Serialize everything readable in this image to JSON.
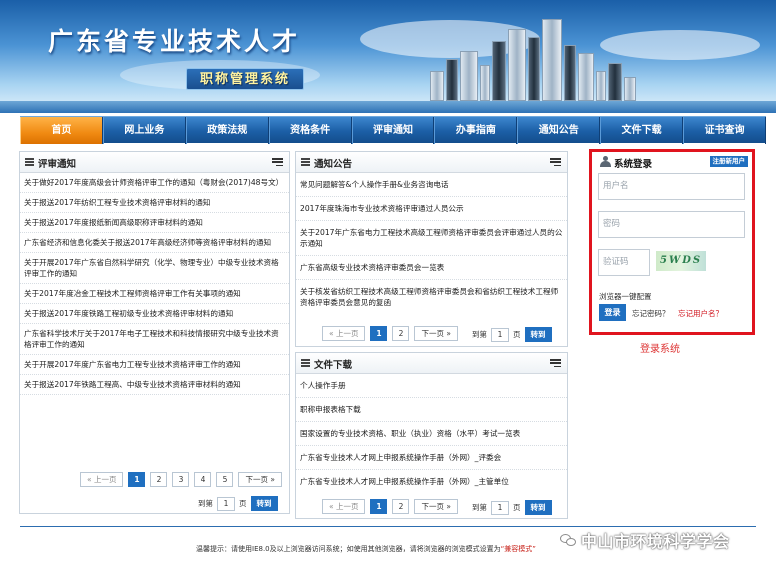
{
  "header": {
    "title": "广东省专业技术人才",
    "subtitle": "职称管理系统"
  },
  "nav": {
    "items": [
      {
        "label": "首页",
        "active": true
      },
      {
        "label": "网上业务"
      },
      {
        "label": "政策法规"
      },
      {
        "label": "资格条件"
      },
      {
        "label": "评审通知"
      },
      {
        "label": "办事指南"
      },
      {
        "label": "通知公告"
      },
      {
        "label": "文件下载"
      },
      {
        "label": "证书查询"
      }
    ]
  },
  "review_notices": {
    "title": "评审通知",
    "items": [
      "关于做好2017年度高级会计师资格评审工作的通知（粤财会(2017)48号文）",
      "关于报送2017年纺织工程专业技术资格评审材料的通知",
      "关于报送2017年度报纸新闻高级职称评审材料的通知",
      "广东省经济和信息化委关于报送2017年高级经济师等资格评审材料的通知",
      "关于开展2017年广东省自然科学研究（化学、物理专业）中级专业技术资格评审工作的通知",
      "关于2017年度冶金工程技术工程师资格评审工作有关事项的通知",
      "关于报送2017年度铁路工程初级专业技术资格评审材料的通知",
      "广东省科学技术厅关于2017年电子工程技术和科技情报研究中级专业技术资格评审工作的通知",
      "关于开展2017年度广东省电力工程专业技术资格评审工作的通知",
      "关于报送2017年铁路工程高、中级专业技术资格评审材料的通知"
    ],
    "pager": {
      "prev": "« 上一页",
      "pages": [
        "1",
        "2",
        "3",
        "4",
        "5"
      ],
      "current": "1",
      "next": "下一页 »",
      "goto_label": "到第",
      "goto_value": "1",
      "page_unit": "页",
      "go": "转到"
    }
  },
  "announcements": {
    "title": "通知公告",
    "items": [
      "常见问题解答&个人操作手册&业务咨询电话",
      "2017年度珠海市专业技术资格评审通过人员公示",
      "关于2017年广东省电力工程技术高级工程师资格评审委员会评审通过人员的公示通知",
      "广东省高级专业技术资格评审委员会一览表",
      "关于核发省纺织工程技术高级工程师资格评审委员会和省纺织工程技术工程师资格评审委员会意见的复函"
    ],
    "pager": {
      "prev": "« 上一页",
      "pages": [
        "1",
        "2"
      ],
      "current": "1",
      "next": "下一页 »",
      "goto_label": "到第",
      "goto_value": "1",
      "page_unit": "页",
      "go": "转到"
    }
  },
  "downloads": {
    "title": "文件下载",
    "items": [
      "个人操作手册",
      "职称申报表格下载",
      "国家设置的专业技术资格、职业（执业）资格（水平）考试一览表",
      "广东省专业技术人才网上申报系统操作手册（外网）_评委会",
      "广东省专业技术人才网上申报系统操作手册（外网）_主管单位"
    ],
    "pager": {
      "prev": "« 上一页",
      "pages": [
        "1",
        "2"
      ],
      "current": "1",
      "next": "下一页 »",
      "goto_label": "到第",
      "goto_value": "1",
      "page_unit": "页",
      "go": "转到"
    }
  },
  "login": {
    "title": "系统登录",
    "register": "注册新用户",
    "username_placeholder": "用户名",
    "password_placeholder": "密码",
    "code_placeholder": "验证码",
    "captcha_text": "5WDS",
    "browser_config": "浏览器一键配置",
    "login_button": "登录",
    "forgot_password": "忘记密码？",
    "forgot_username": "忘记用户名？",
    "caption": "登录系统"
  },
  "footer": {
    "tip_prefix": "温馨提示：请使用IE8.0及以上浏览器访问系统；如使用其他浏览器，请将浏览器的浏览模式设置为",
    "tip_highlight": "“兼容模式”"
  },
  "watermark": {
    "text": "中山市环境科学学会",
    "icon": "wechat-icon"
  },
  "colors": {
    "nav_blue": "#1c5fa6",
    "nav_active": "#f08a12",
    "accent_blue": "#1f6fc0",
    "login_border": "#e0141e"
  }
}
